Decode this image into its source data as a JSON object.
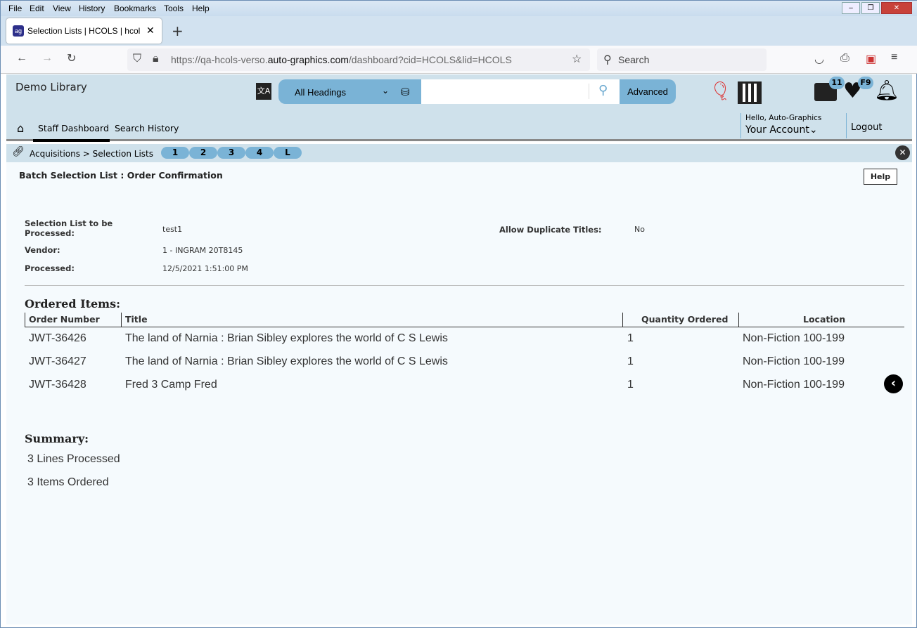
{
  "browser": {
    "menu": [
      "File",
      "Edit",
      "View",
      "History",
      "Bookmarks",
      "Tools",
      "Help"
    ],
    "tab_title": "Selection Lists | HCOLS | hcols |",
    "url_prefix": "https://qa-hcols-verso.",
    "url_domain": "auto-graphics.com",
    "url_suffix": "/dashboard?cid=HCOLS&lid=HCOLS",
    "search_placeholder": "Search"
  },
  "header": {
    "library": "Demo Library",
    "search_scope": "All Headings",
    "search_value": "",
    "advanced": "Advanced",
    "list_badge": "11",
    "fav_badge": "F9",
    "hello": "Hello, Auto-Graphics",
    "account": "Your Account",
    "logout": "Logout",
    "nav": [
      "Staff Dashboard",
      "Search History"
    ]
  },
  "breadcrumb": {
    "path": "Acquisitions > Selection Lists",
    "pills": [
      "1",
      "2",
      "3",
      "4",
      "L"
    ]
  },
  "page": {
    "title": "Batch Selection List : Order Confirmation",
    "help": "Help",
    "fields": {
      "list_label": "Selection List to be Processed:",
      "list_value": "test1",
      "dup_label": "Allow Duplicate Titles:",
      "dup_value": "No",
      "vendor_label": "Vendor:",
      "vendor_value": "1 - INGRAM 20T8145",
      "processed_label": "Processed:",
      "processed_value": "12/5/2021 1:51:00 PM"
    },
    "ordered_heading": "Ordered Items:",
    "columns": [
      "Order Number",
      "Title",
      "Quantity Ordered",
      "Location"
    ],
    "rows": [
      {
        "order": "JWT-36426",
        "title": "The land of Narnia : Brian Sibley explores the world of C S Lewis",
        "qty": "1",
        "location": "Non-Fiction 100-199"
      },
      {
        "order": "JWT-36427",
        "title": "The land of Narnia : Brian Sibley explores the world of C S Lewis",
        "qty": "1",
        "location": "Non-Fiction 100-199"
      },
      {
        "order": "JWT-36428",
        "title": "Fred 3 Camp Fred",
        "qty": "1",
        "location": "Non-Fiction 100-199"
      }
    ],
    "summary_heading": "Summary:",
    "summary": [
      "3 Lines Processed",
      "3 Items Ordered"
    ]
  }
}
